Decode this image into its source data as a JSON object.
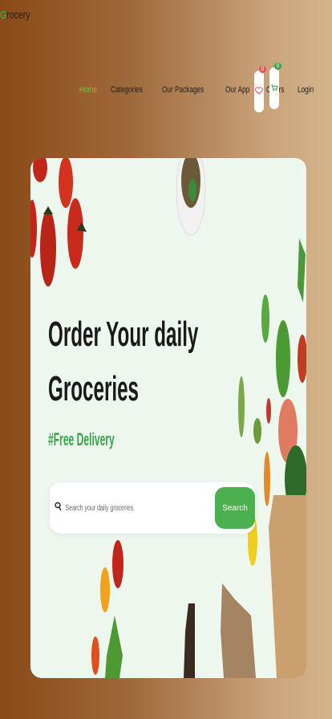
{
  "brand": {
    "prefix": "G",
    "rest": "rocery"
  },
  "nav": {
    "items": [
      "Home",
      "Categories",
      "Our Packages",
      "Our App",
      "Offers",
      "Login"
    ],
    "active": "Home"
  },
  "header_icons": {
    "wishlist_badge": "0",
    "cart_badge": "0",
    "wishlist_icon": "heart-icon",
    "cart_icon": "cart-icon"
  },
  "hero": {
    "title_line1": "Order Your daily",
    "title_line2": "Groceries",
    "tagline": "#Free Delivery",
    "search_placeholder": "Search your daily groceries",
    "search_button": "Search"
  },
  "colors": {
    "accent": "#4caf50",
    "active_nav": "#7fbf3f",
    "badge_red": "#e55353",
    "badge_green": "#3aa34a",
    "card_bg": "#edf7ee"
  }
}
